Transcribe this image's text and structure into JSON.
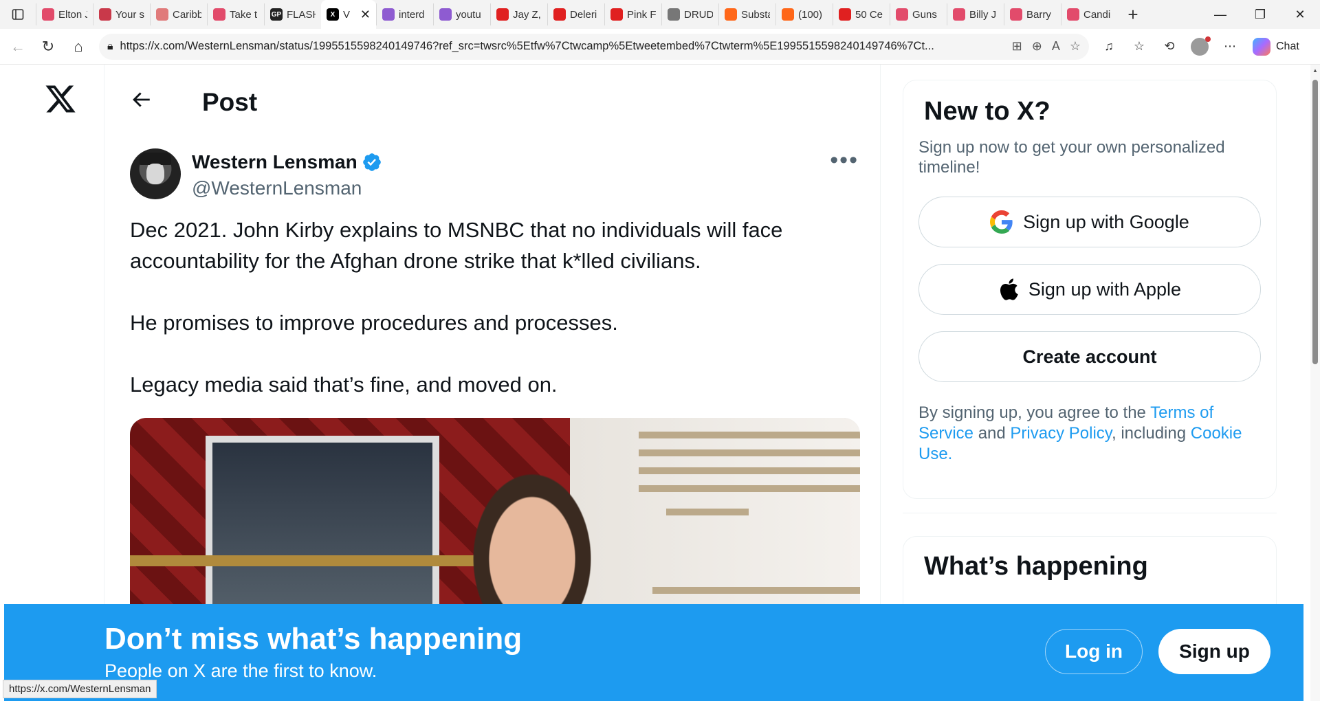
{
  "browser": {
    "tabs": [
      {
        "title": "Elton J",
        "icon_color": "#e24b6b"
      },
      {
        "title": "Your s",
        "icon_color": "#c9394a"
      },
      {
        "title": "Caribb",
        "icon_color": "#e07a7a"
      },
      {
        "title": "Take t",
        "icon_color": "#e24b6b"
      },
      {
        "title": "FLASH",
        "icon_color": "#222222",
        "icon_text": "GP"
      },
      {
        "title": "interd",
        "icon_color": "#8e5bd1"
      },
      {
        "title": "youtu",
        "icon_color": "#8e5bd1"
      },
      {
        "title": "Jay Z,",
        "icon_color": "#e02020"
      },
      {
        "title": "Deleri",
        "icon_color": "#e02020"
      },
      {
        "title": "Pink F",
        "icon_color": "#e02020"
      },
      {
        "title": "DRUD",
        "icon_color": "#777777"
      },
      {
        "title": "Substa",
        "icon_color": "#ff6719"
      },
      {
        "title": "(100)",
        "icon_color": "#ff6719"
      },
      {
        "title": "50 Ce",
        "icon_color": "#e02020"
      },
      {
        "title": "Guns",
        "icon_color": "#e24b6b"
      },
      {
        "title": "Billy J",
        "icon_color": "#e24b6b"
      },
      {
        "title": "Barry",
        "icon_color": "#e24b6b"
      },
      {
        "title": "Candi",
        "icon_color": "#e24b6b"
      }
    ],
    "active_tab": {
      "title": "V"
    },
    "url": "https://x.com/WesternLensman/status/1995515598240149746?ref_src=twsrc%5Etfw%7Ctwcamp%5Etweetembed%7Ctwterm%5E1995515598240149746%7Ct...",
    "chat_label": "Chat",
    "status_url": "https://x.com/WesternLensman"
  },
  "page": {
    "header_title": "Post",
    "tweet": {
      "author_name": "Western Lensman",
      "author_handle": "@WesternLensman",
      "paragraphs": [
        "Dec 2021. John Kirby explains to MSNBC that no individuals will face accountability for the Afghan drone strike that k*lled civilians.",
        "He promises to improve procedures and processes.",
        "Legacy media said that’s fine, and moved on."
      ]
    },
    "sidebar": {
      "signup_title": "New to X?",
      "signup_subtitle": "Sign up now to get your own personalized timeline!",
      "google_label": "Sign up with Google",
      "apple_label": "Sign up with Apple",
      "create_label": "Create account",
      "legal_prefix": "By signing up, you agree to the ",
      "legal_terms": "Terms of Service",
      "legal_and": " and ",
      "legal_privacy": "Privacy Policy",
      "legal_including": ", including ",
      "legal_cookie": "Cookie Use.",
      "whats_happening": "What’s happening"
    },
    "banner": {
      "title": "Don’t miss what’s happening",
      "subtitle": "People on X are the first to know.",
      "login_label": "Log in",
      "signup_label": "Sign up"
    },
    "colors": {
      "accent": "#1d9bf0",
      "text": "#0f1419",
      "secondary": "#536471"
    }
  }
}
